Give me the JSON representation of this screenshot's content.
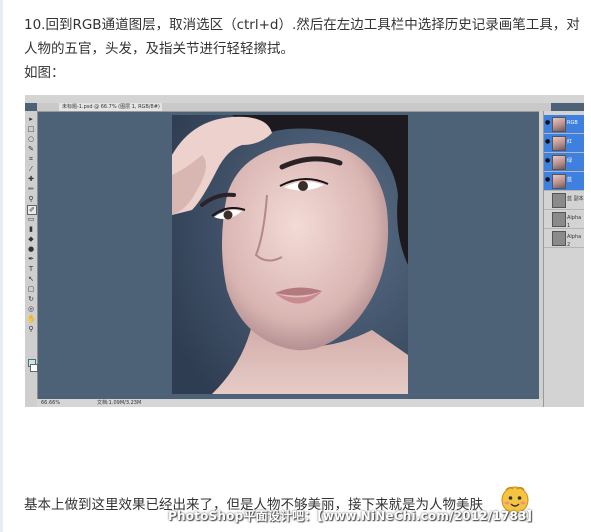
{
  "text": {
    "step": "10.回到RGB通道图层，取消选区（ctrl+d）.然后在左边工具栏中选择历史记录画笔工具，对人物的五官，头发，及指关节进行轻轻擦拭。",
    "figure_label": "如图：",
    "conclusion": "基本上做到这里效果已经出来了，但是人物不够美丽，接下来就是为人物美肤"
  },
  "screenshot": {
    "doc_tab": "未标题-1.psd @ 66.7% (图层 1, RGB/8#)",
    "status_zoom": "66.66%",
    "status_doc": "文档:1.09M/3.23M",
    "channels": [
      {
        "label": "RGB",
        "selected": true
      },
      {
        "label": "红",
        "selected": true
      },
      {
        "label": "绿",
        "selected": true
      },
      {
        "label": "蓝",
        "selected": true
      },
      {
        "label": "蓝 副本",
        "selected": false
      },
      {
        "label": "Alpha 1",
        "selected": false
      },
      {
        "label": "Alpha 2",
        "selected": false
      }
    ]
  },
  "watermark": "PhotoShop平面设计吧：【www.NiNeChi.com/2012/1783】",
  "colors": {
    "canvas_bg": "#4d6277",
    "selection": "#3d80df",
    "fg_swatch": "#bde9ef"
  },
  "icons": [
    "history-brush-icon",
    "eye-icon",
    "smiley-emoji-icon"
  ]
}
